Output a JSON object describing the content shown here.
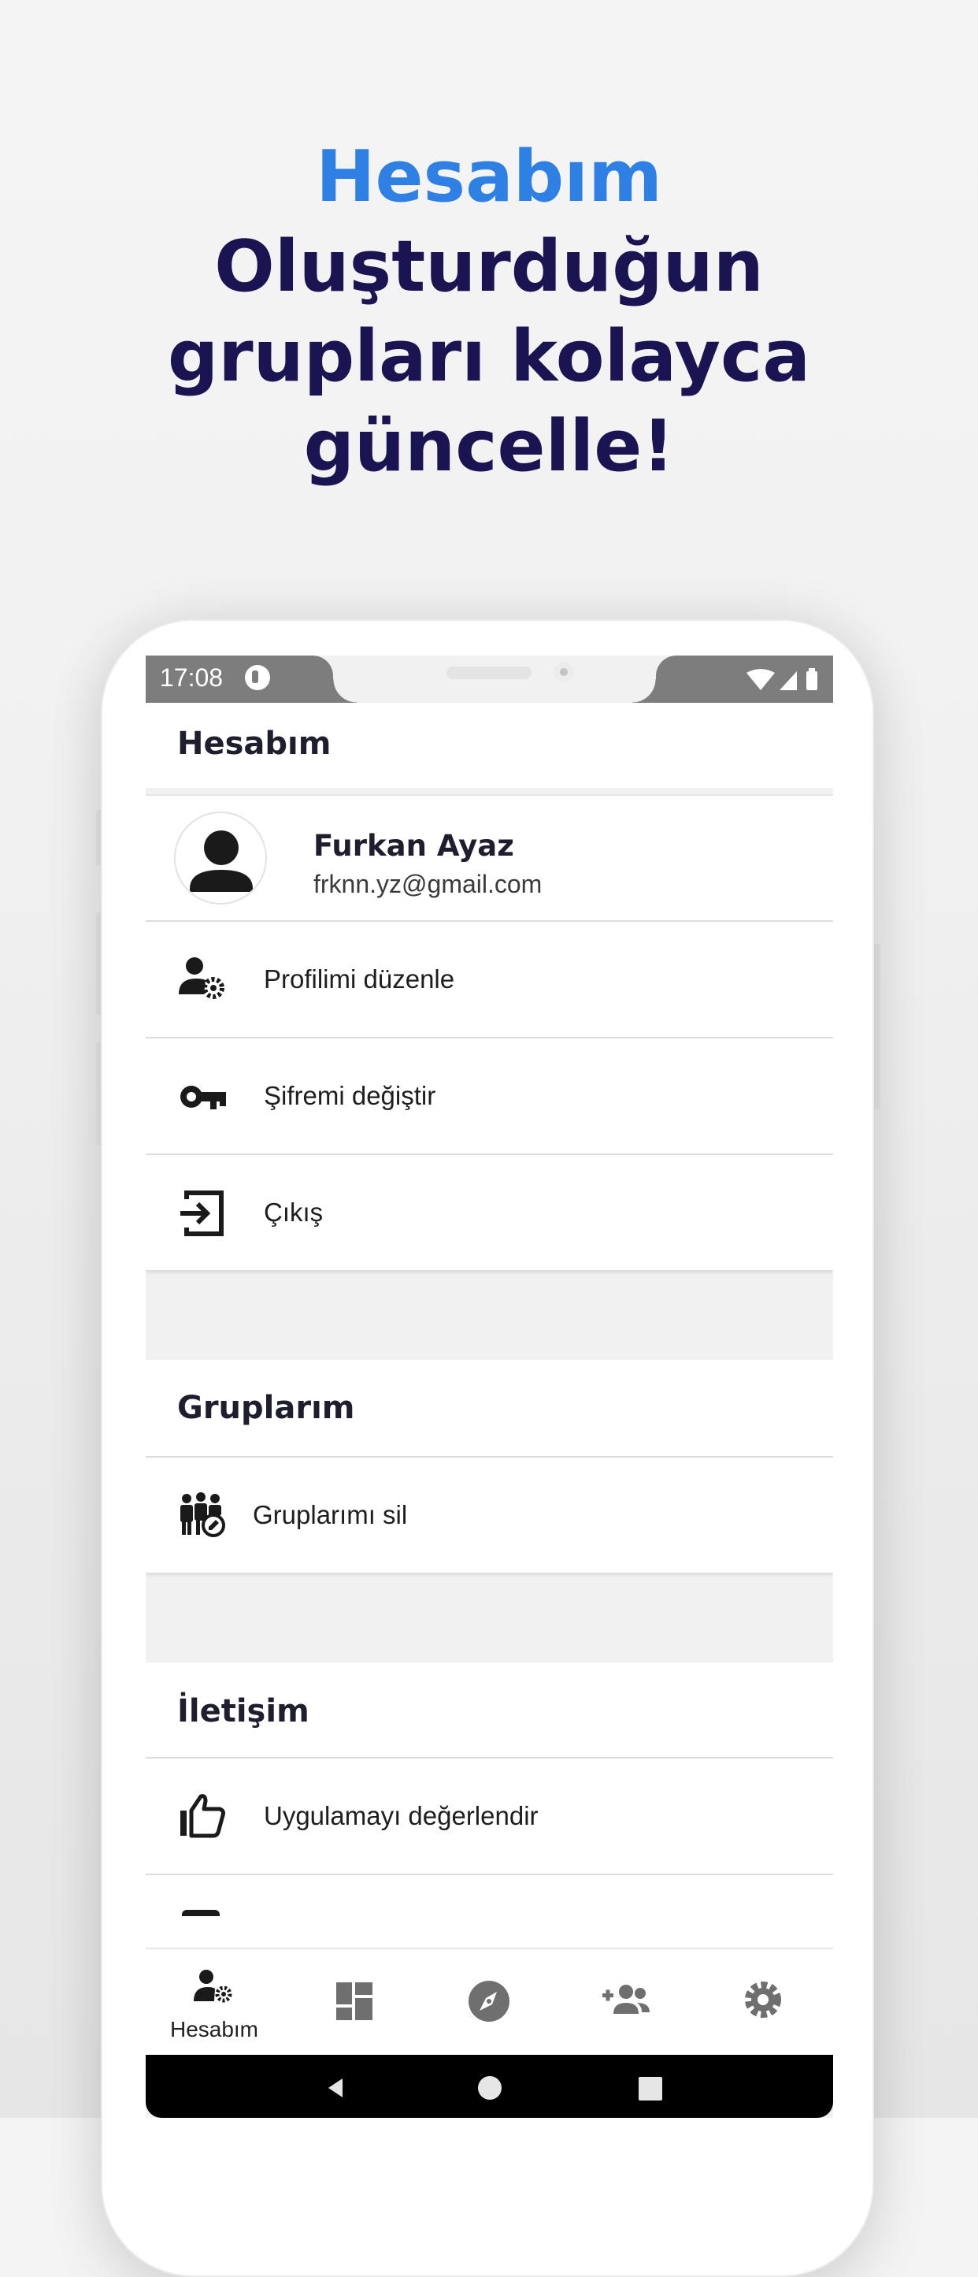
{
  "headline": {
    "accent": "Hesabım",
    "line1": "Oluşturduğun",
    "line2": "grupları kolayca",
    "line3": "güncelle!"
  },
  "status_bar": {
    "time": "17:08"
  },
  "account": {
    "section_title": "Hesabım",
    "user_name": "Furkan Ayaz",
    "user_email": "frknn.yz@gmail.com",
    "items": [
      {
        "label": "Profilimi düzenle",
        "icon": "user-settings-icon"
      },
      {
        "label": "Şifremi değiştir",
        "icon": "key-icon"
      },
      {
        "label": "Çıkış",
        "icon": "logout-icon"
      }
    ]
  },
  "groups": {
    "section_title": "Gruplarım",
    "items": [
      {
        "label": "Gruplarımı sil",
        "icon": "group-edit-icon"
      }
    ]
  },
  "contact": {
    "section_title": "İletişim",
    "items": [
      {
        "label": "Uygulamayı değerlendir",
        "icon": "thumbs-up-icon"
      }
    ]
  },
  "bottom_nav": {
    "items": [
      {
        "label": "Hesabım",
        "icon": "account-settings-icon",
        "active": true
      },
      {
        "label": "",
        "icon": "dashboard-icon",
        "active": false
      },
      {
        "label": "",
        "icon": "compass-icon",
        "active": false
      },
      {
        "label": "",
        "icon": "add-group-icon",
        "active": false
      },
      {
        "label": "",
        "icon": "gear-icon",
        "active": false
      }
    ]
  },
  "colors": {
    "accent": "#2f80e4",
    "headline": "#1b1452",
    "nav_inactive": "#6f6f6f"
  }
}
